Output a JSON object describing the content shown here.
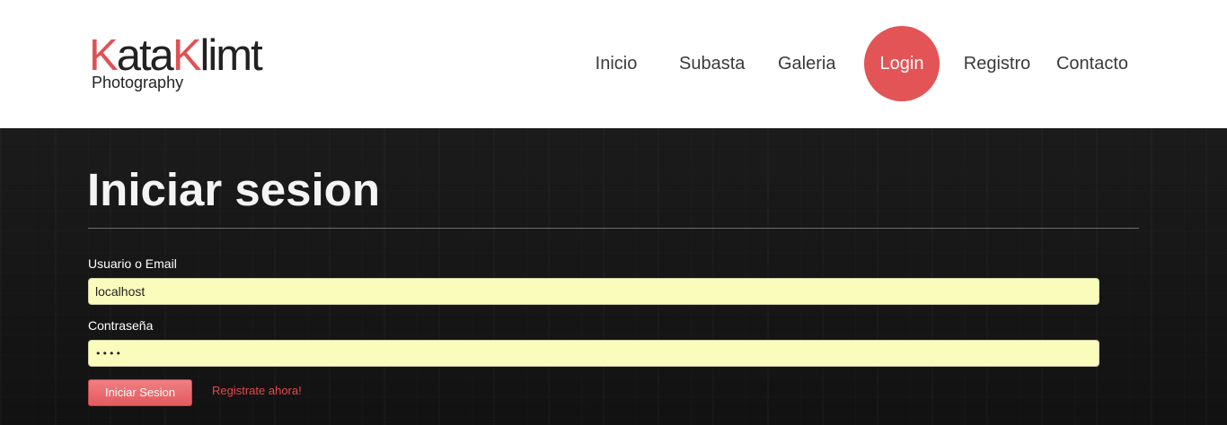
{
  "brand": {
    "logo_first_letter": "K",
    "logo_part1": "ata",
    "logo_second_letter": "K",
    "logo_part2": "limt",
    "tagline": "Photography",
    "accent_color": "#e35457"
  },
  "nav": {
    "items": [
      {
        "label": "Inicio",
        "active": false
      },
      {
        "label": "Subasta",
        "active": false
      },
      {
        "label": "Galeria",
        "active": false
      },
      {
        "label": "Login",
        "active": true
      },
      {
        "label": "Registro",
        "active": false
      },
      {
        "label": "Contacto",
        "active": false
      }
    ]
  },
  "login": {
    "title": "Iniciar sesion",
    "username_label": "Usuario o Email",
    "username_value": "localhost",
    "password_label": "Contraseña",
    "password_value": "••••",
    "submit_label": "Iniciar Sesion",
    "register_link": "Registrate ahora!"
  },
  "colors": {
    "background_dark": "#141414",
    "input_background": "#fafcbc",
    "link_color": "#e6484c"
  }
}
